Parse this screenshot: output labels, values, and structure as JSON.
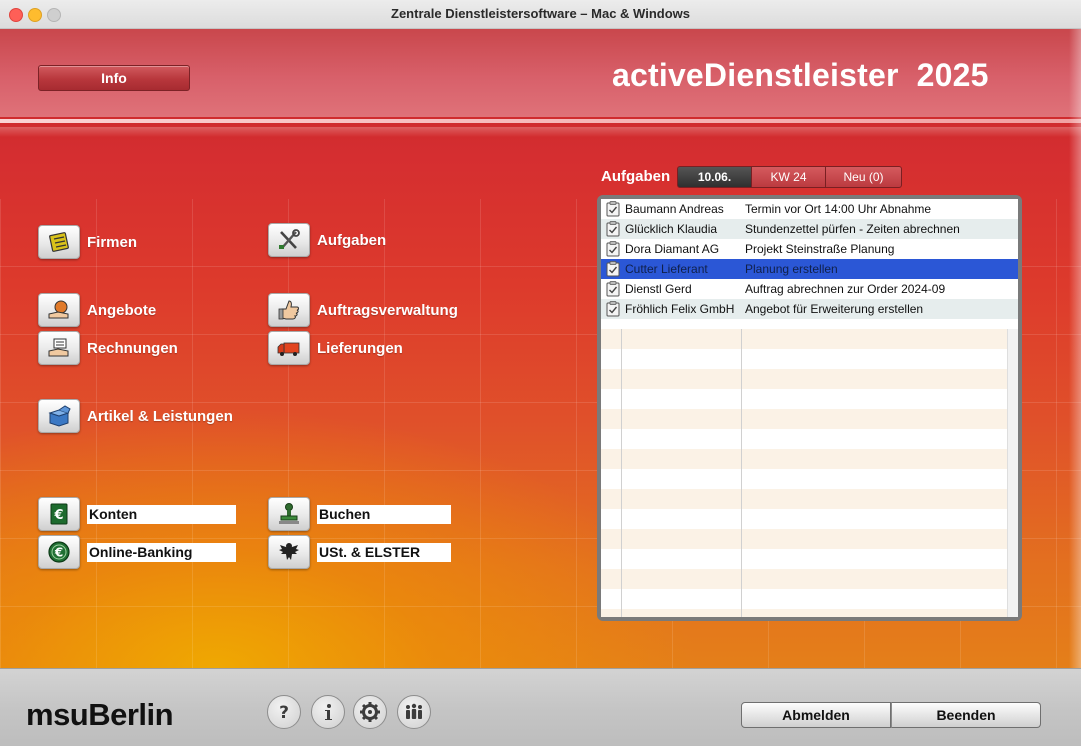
{
  "window": {
    "title": "Zentrale Dienstleistersoftware – Mac & Windows"
  },
  "header": {
    "info_label": "Info",
    "app_name": "activeDienstleister",
    "year": "2025"
  },
  "launcher": {
    "firmen": "Firmen",
    "aufgaben": "Aufgaben",
    "angebote": "Angebote",
    "auftragsverwaltung": "Auftragsverwaltung",
    "rechnungen": "Rechnungen",
    "lieferungen": "Lieferungen",
    "artikel": "Artikel & Leistungen",
    "konten": "Konten",
    "buchen": "Buchen",
    "online_banking": "Online-Banking",
    "ust_elster": "USt. & ELSTER"
  },
  "tasks": {
    "label": "Aufgaben",
    "tabs": {
      "date": "10.06.",
      "week": "KW 24",
      "new": "Neu (0)"
    },
    "rows": [
      {
        "name": "Baumann Andreas",
        "task": "Termin vor Ort 14:00 Uhr Abnahme"
      },
      {
        "name": "Glücklich Klaudia",
        "task": "Stundenzettel pürfen - Zeiten abrechnen"
      },
      {
        "name": "Dora Diamant AG",
        "task": "Projekt Steinstraße Planung"
      },
      {
        "name": "Cutter Lieferant",
        "task": "Planung erstellen"
      },
      {
        "name": "Dienstl Gerd",
        "task": "Auftrag abrechnen zur Order 2024-09"
      },
      {
        "name": "Fröhlich Felix GmbH",
        "task": "Angebot für Erweiterung erstellen"
      }
    ]
  },
  "footer": {
    "logo": "msuBerlin",
    "logout": "Abmelden",
    "quit": "Beenden"
  }
}
